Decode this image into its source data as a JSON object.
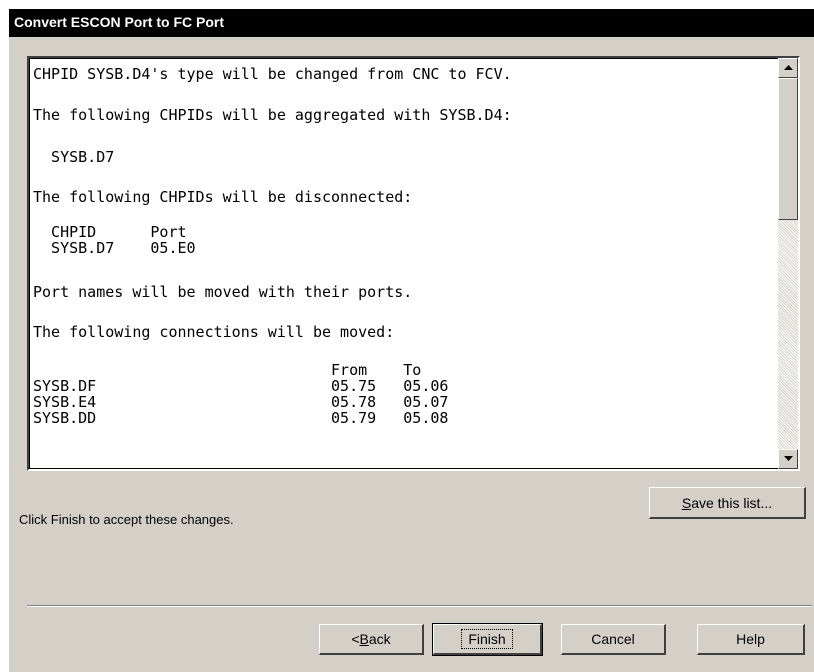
{
  "window": {
    "title": "Convert ESCON Port to FC Port"
  },
  "report": {
    "lines": [
      "CHPID SYSB.D4's type will be changed from CNC to FCV.",
      "The following CHPIDs will be aggregated with SYSB.D4:",
      "  SYSB.D7",
      "The following CHPIDs will be disconnected:",
      "  CHPID      Port",
      "  SYSB.D7    05.E0",
      "Port names will be moved with their ports.",
      "The following connections will be moved:",
      "                                 From    To",
      "SYSB.DF                          05.75   05.06",
      "SYSB.E4                          05.78   05.07",
      "SYSB.DD                          05.79   05.08"
    ]
  },
  "save_button": {
    "label_pre": "",
    "label_u": "S",
    "label_post": "ave this list..."
  },
  "instruction": "Click Finish to accept these changes.",
  "buttons": {
    "back": {
      "label_pre": "< ",
      "label_u": "B",
      "label_post": "ack"
    },
    "finish": "Finish",
    "cancel": "Cancel",
    "help": "Help"
  }
}
